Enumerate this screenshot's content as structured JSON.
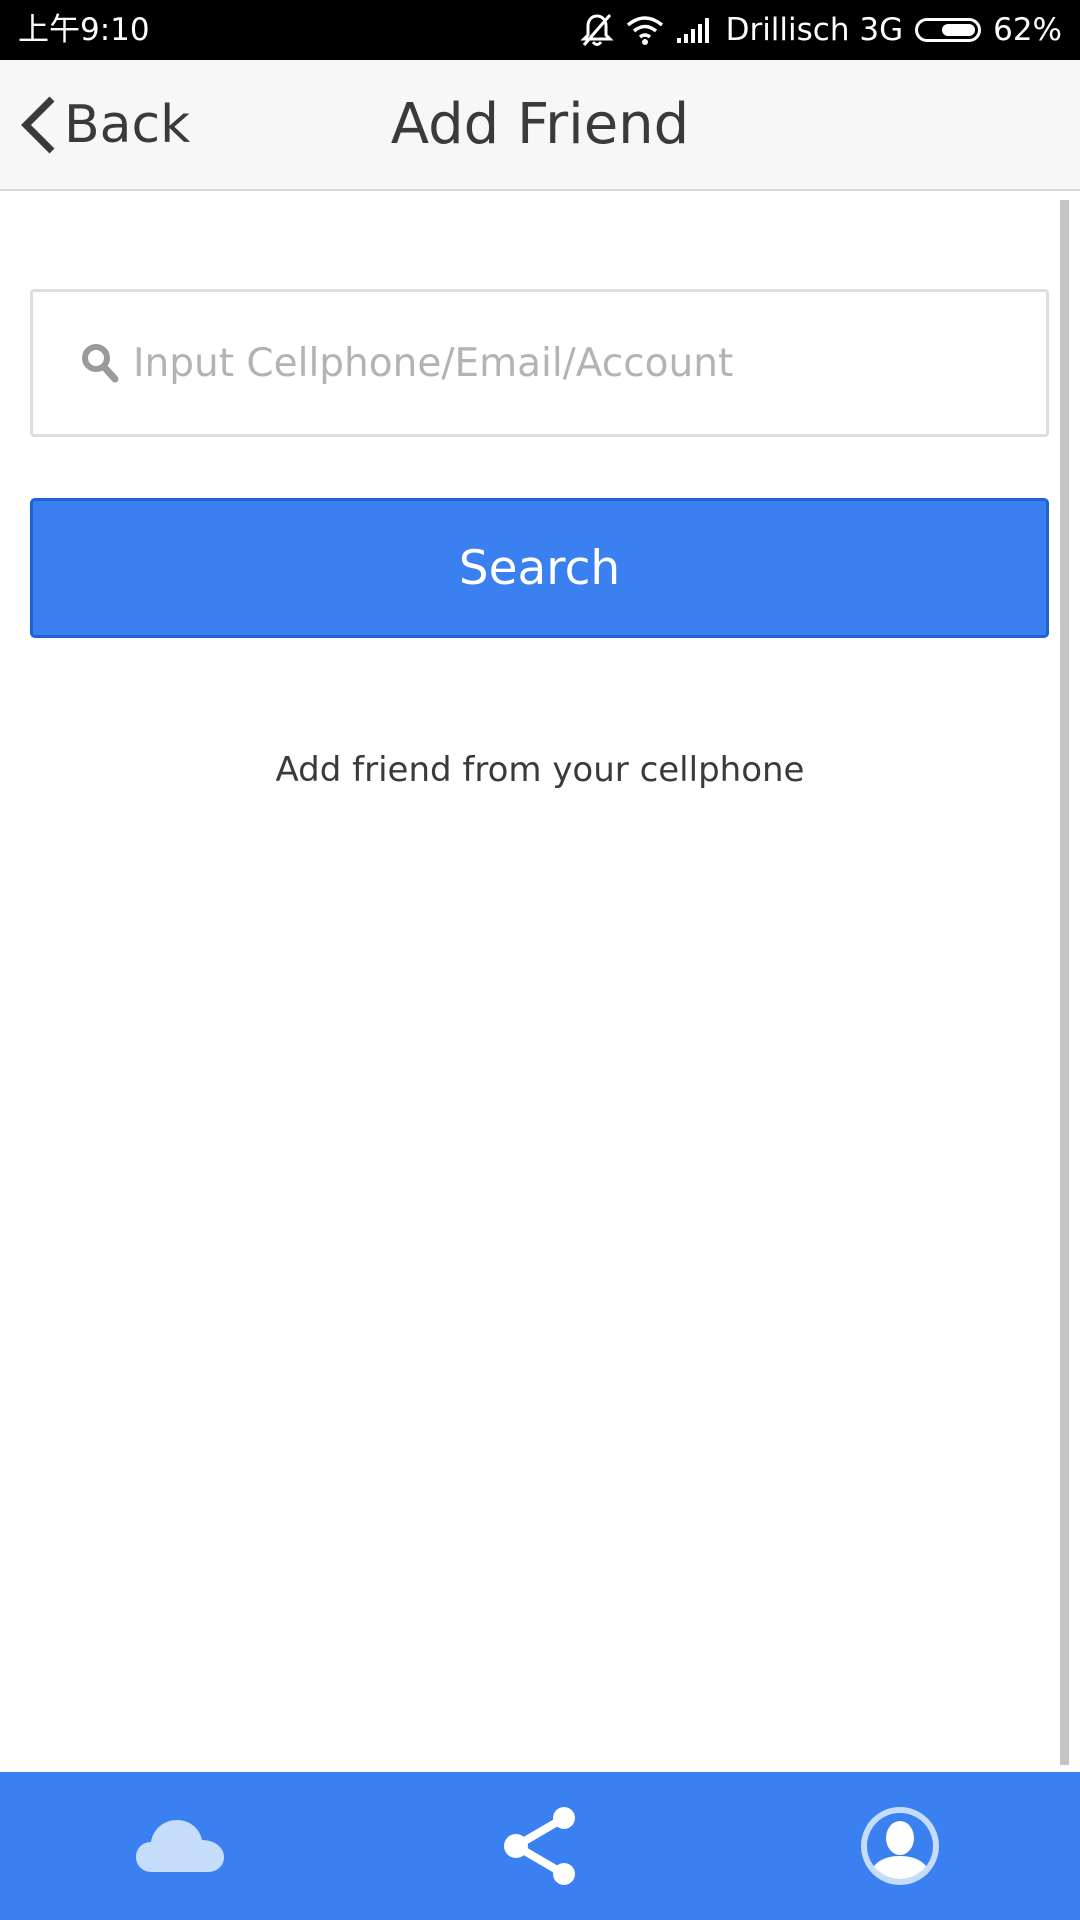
{
  "status_bar": {
    "time": "上午9:10",
    "carrier": "Drillisch 3G",
    "battery_percent": "62%",
    "battery_level": 0.62,
    "icons": [
      "bell-off-icon",
      "wifi-icon",
      "signal-icon",
      "battery-icon"
    ]
  },
  "header": {
    "back_label": "Back",
    "title": "Add Friend"
  },
  "search": {
    "placeholder": "Input Cellphone/Email/Account",
    "value": "",
    "button_label": "Search"
  },
  "hint": "Add friend from your cellphone",
  "bottom_nav": {
    "items": [
      "cloud-icon",
      "share-icon",
      "profile-icon"
    ]
  },
  "colors": {
    "accent": "#3a80f0",
    "header_bg": "#f7f7f7",
    "status_bar_bg": "#000000",
    "text": "#3a3a3a",
    "placeholder": "#b3b3b3"
  }
}
